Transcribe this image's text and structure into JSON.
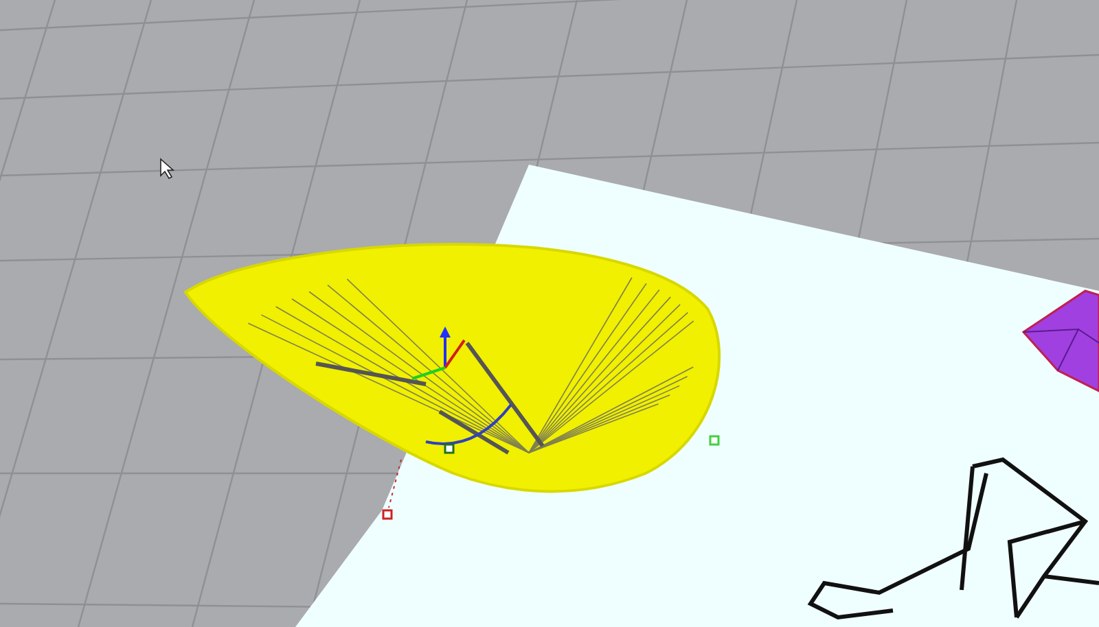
{
  "viewport": {
    "grid": true
  },
  "objects": [
    {
      "kind": "bowl",
      "selected": true
    },
    {
      "kind": "gem",
      "selected": false
    },
    {
      "kind": "wireframe",
      "selected": false
    }
  ]
}
